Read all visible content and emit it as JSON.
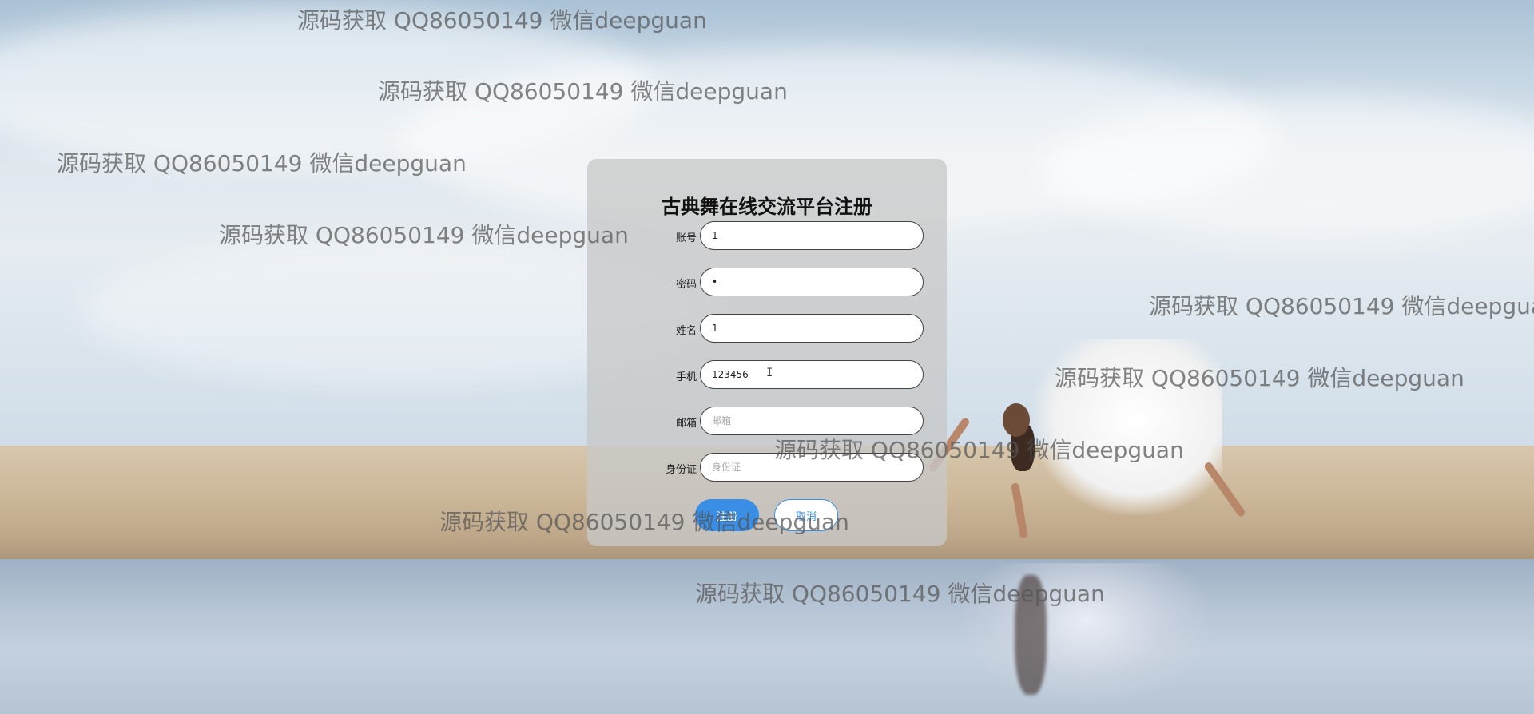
{
  "form": {
    "title": "古典舞在线交流平台注册",
    "fields": [
      {
        "label": "账号",
        "value": "1",
        "placeholder": "账号",
        "type": "text"
      },
      {
        "label": "密码",
        "value": "•",
        "placeholder": "密码",
        "type": "text"
      },
      {
        "label": "姓名",
        "value": "1",
        "placeholder": "姓名",
        "type": "text"
      },
      {
        "label": "手机",
        "value": "123456",
        "placeholder": "手机",
        "type": "text"
      },
      {
        "label": "邮箱",
        "value": "",
        "placeholder": "邮箱",
        "type": "text"
      },
      {
        "label": "身份证",
        "value": "",
        "placeholder": "身份证",
        "type": "text"
      }
    ],
    "register_label": "注册",
    "cancel_label": "取消"
  },
  "watermark": {
    "text": "源码获取 QQ86050149 微信deepguan"
  },
  "colors": {
    "accent": "#3a8ee6",
    "panel": "#c8c8c8"
  }
}
